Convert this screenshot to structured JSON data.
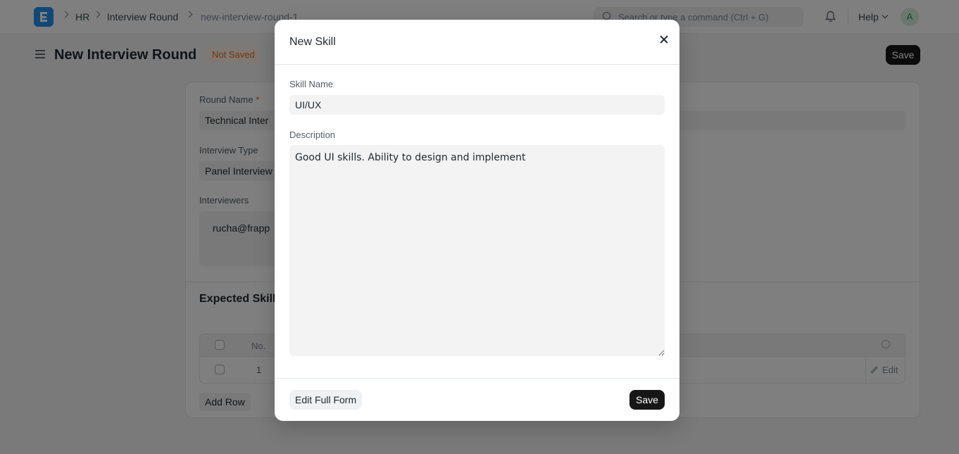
{
  "navbar": {
    "breadcrumbs": [
      "HR",
      "Interview Round",
      "new-interview-round-1"
    ],
    "search_placeholder": "Search or type a command (Ctrl + G)",
    "help_label": "Help",
    "avatar_initial": "A"
  },
  "page": {
    "title": "New Interview Round",
    "status": "Not Saved",
    "save_label": "Save"
  },
  "form": {
    "round_name_label": "Round Name",
    "round_name_required_mark": "*",
    "round_name_value": "Technical Inter",
    "interview_type_label": "Interview Type",
    "interview_type_value": "Panel Interview",
    "interviewers_label": "Interviewers",
    "interviewers_value": "rucha@frapp",
    "expected_skills_title": "Expected Skill",
    "grid": {
      "no_header": "No.",
      "row_number": "1",
      "edit_label": "Edit"
    },
    "add_row_label": "Add Row"
  },
  "modal": {
    "title": "New Skill",
    "skill_name_label": "Skill Name",
    "skill_name_value": "UI/UX",
    "description_label": "Description",
    "description_value": "Good UI skills. Ability to design and implement",
    "edit_full_form_label": "Edit Full Form",
    "save_label": "Save"
  },
  "colors": {
    "primary_button": "#171717",
    "status_badge_text": "#e86c13",
    "logo": "#2490ef"
  }
}
